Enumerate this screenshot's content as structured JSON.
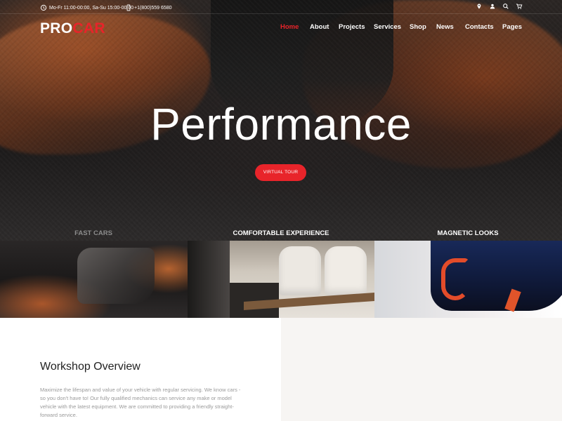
{
  "topbar": {
    "hours": "Mo-Fr 11:00-00:00, Sa-Su 15:00-00:00",
    "phone": "+1(800)559 6580",
    "icons": [
      "map-pin-icon",
      "user-icon",
      "search-icon",
      "cart-icon"
    ]
  },
  "logo": {
    "part1": "PRO",
    "part2": "CAR"
  },
  "nav": {
    "items": [
      {
        "label": "Home",
        "active": true
      },
      {
        "label": "About"
      },
      {
        "label": "Projects"
      },
      {
        "label": "Services"
      },
      {
        "label": "Shop"
      },
      {
        "label": "News"
      },
      {
        "label": "Contacts"
      },
      {
        "label": "Pages"
      }
    ]
  },
  "hero": {
    "title": "Performance",
    "button": "VIRTUAL TOUR"
  },
  "features": [
    {
      "label": "FAST CARS"
    },
    {
      "label": "COMFORTABLE EXPERIENCE"
    },
    {
      "label": "MAGNETIC LOOKS"
    }
  ],
  "overview": {
    "title": "Workshop Overview",
    "body": "Maximize the lifespan and value of your vehicle with regular servicing. We know cars - so you don't have to! Our fully qualified mechanics can service any make or model vehicle with the latest equipment. We are committed to providing a friendly straight-forward service."
  },
  "colors": {
    "accent": "#e8242a",
    "hero_bg": "#1c1a1a",
    "body_text": "#9a9a9a"
  }
}
